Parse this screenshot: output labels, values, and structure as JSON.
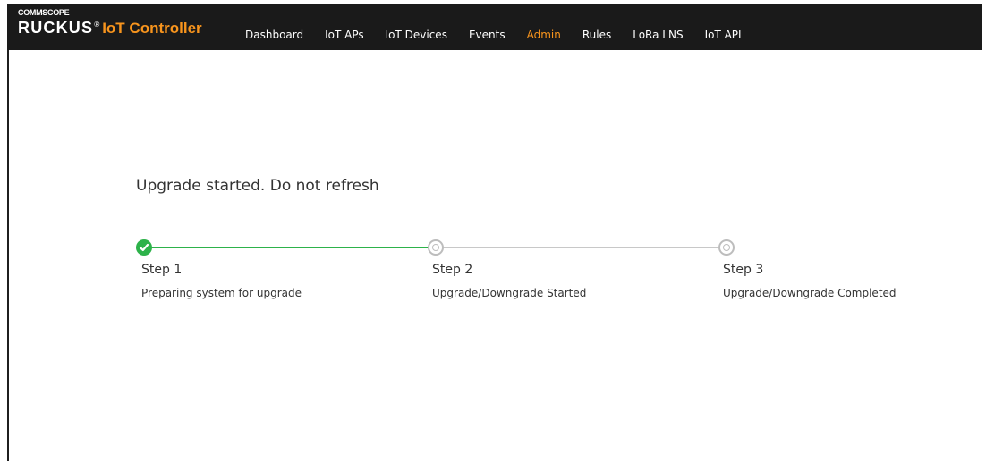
{
  "brand": {
    "company": "COMMSCOPE",
    "name": "RUCKUS",
    "registered": "®",
    "product": "IoT Controller"
  },
  "nav": [
    {
      "label": "Dashboard",
      "active": false
    },
    {
      "label": "IoT APs",
      "active": false
    },
    {
      "label": "IoT Devices",
      "active": false
    },
    {
      "label": "Events",
      "active": false
    },
    {
      "label": "Admin",
      "active": true
    },
    {
      "label": "Rules",
      "active": false
    },
    {
      "label": "LoRa LNS",
      "active": false
    },
    {
      "label": "IoT API",
      "active": false
    }
  ],
  "main": {
    "status_message": "Upgrade started. Do not refresh"
  },
  "steps": [
    {
      "label": "Step 1",
      "description": "Preparing system for upgrade",
      "state": "completed"
    },
    {
      "label": "Step 2",
      "description": "Upgrade/Downgrade Started",
      "state": "pending"
    },
    {
      "label": "Step 3",
      "description": "Upgrade/Downgrade Completed",
      "state": "pending"
    }
  ],
  "colors": {
    "header_bg": "#1a1a1a",
    "accent": "#f7941d",
    "success": "#2db24a",
    "inactive": "#c8c8c8"
  },
  "icons": {
    "completed": "check-circle-icon",
    "pending": "radio-circle-icon"
  }
}
